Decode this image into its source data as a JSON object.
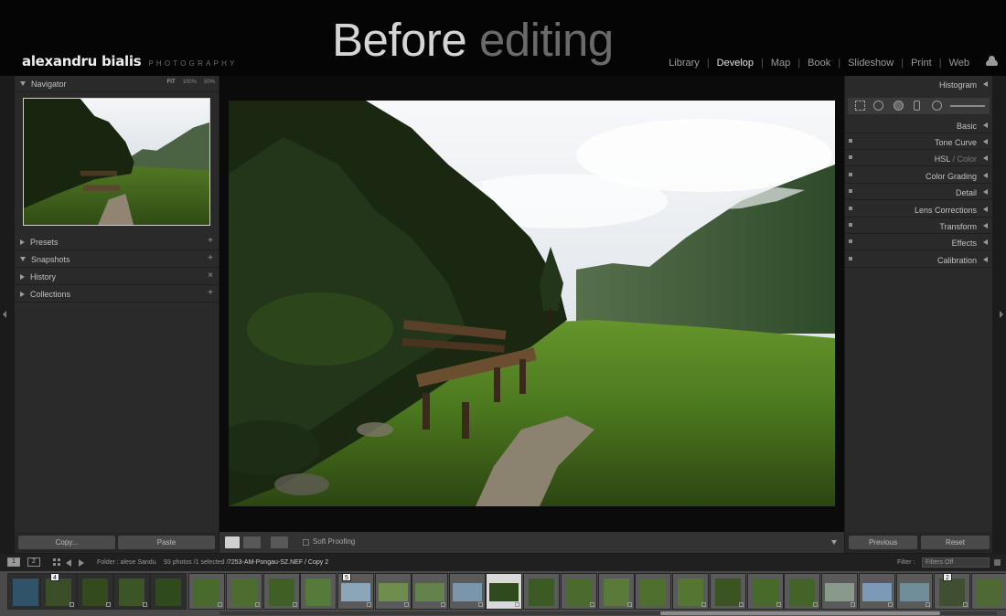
{
  "overlay": {
    "headline_a": "Before",
    "headline_b": "editing"
  },
  "identity": {
    "name": "alexandru bialis",
    "sub": "PHOTOGRAPHY"
  },
  "modules": [
    {
      "label": "Library",
      "active": false
    },
    {
      "label": "Develop",
      "active": true
    },
    {
      "label": "Map",
      "active": false
    },
    {
      "label": "Book",
      "active": false
    },
    {
      "label": "Slideshow",
      "active": false
    },
    {
      "label": "Print",
      "active": false
    },
    {
      "label": "Web",
      "active": false
    }
  ],
  "left_panel": {
    "navigator": {
      "title": "Navigator",
      "zoom_fit": "FIT",
      "zoom_100": "100%",
      "zoom_50": "50%"
    },
    "sections": [
      {
        "label": "Presets",
        "action": "+"
      },
      {
        "label": "Snapshots",
        "action": "+"
      },
      {
        "label": "History",
        "action": "×"
      },
      {
        "label": "Collections",
        "action": "+"
      }
    ],
    "copy_label": "Copy...",
    "paste_label": "Paste"
  },
  "toolbar": {
    "soft_proofing": "Soft Proofing"
  },
  "right_panel": {
    "histogram_title": "Histogram",
    "sections": [
      {
        "label": "Basic",
        "switch": false
      },
      {
        "label": "Tone Curve",
        "switch": true
      },
      {
        "label": "HSL",
        "label_dim": " / Color",
        "switch": true
      },
      {
        "label": "Color Grading",
        "switch": true
      },
      {
        "label": "Detail",
        "switch": true
      },
      {
        "label": "Lens Corrections",
        "switch": true
      },
      {
        "label": "Transform",
        "switch": true
      },
      {
        "label": "Effects",
        "switch": true
      },
      {
        "label": "Calibration",
        "switch": true
      }
    ],
    "previous_label": "Previous",
    "reset_label": "Reset"
  },
  "filmbar": {
    "screen_1": "1",
    "screen_2": "2",
    "folder": "Folder : alese Sandu",
    "count": "93 photos /1 selected /",
    "filename": "7253-AM-Pongau-SZ.NEF / Copy 2",
    "filter_label": "Filter :",
    "filter_value": "Filters Off"
  },
  "filmstrip": {
    "stack_badges": [
      "4",
      "5",
      "2"
    ]
  },
  "colors": {
    "panel": "#2a2a2a",
    "topbar": "#050505",
    "accent_text": "#e0e0e0"
  }
}
